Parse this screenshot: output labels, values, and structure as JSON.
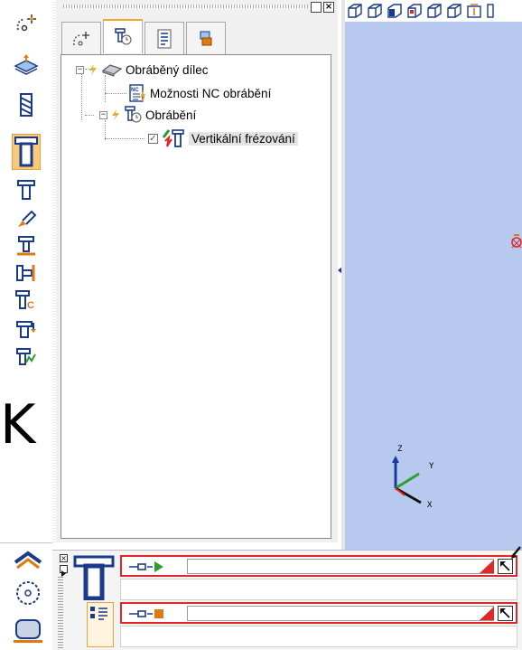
{
  "window": {
    "minimize_label": "",
    "close_label": "×"
  },
  "left_toolbar": {
    "active_index": 3,
    "icons": [
      "point-cursor-icon",
      "stock-layer-icon",
      "drill-icon",
      "vertical-mill-icon",
      "vertical-mill-small-icon",
      "pencil-mill-icon",
      "contour-mill-icon",
      "side-mill-icon",
      "nc-mill-icon",
      "mill-arrow-icon",
      "mill-chart-icon"
    ],
    "overlay_glyph": "K"
  },
  "left_bottom": {
    "icons": [
      "roof-icon",
      "saw-blade-icon",
      "rounded-rect-icon"
    ]
  },
  "panel_tabs": [
    {
      "icon": "point-tab-icon",
      "selected": false
    },
    {
      "icon": "operations-tab-icon",
      "selected": true
    },
    {
      "icon": "document-tab-icon",
      "selected": false
    },
    {
      "icon": "stack-tab-icon",
      "selected": false
    }
  ],
  "tree": {
    "nodes": [
      {
        "label": "Obráběný dílec",
        "icon": "workpiece-icon",
        "expanded": true
      },
      {
        "label": "Možnosti NC obrábění",
        "icon": "nc-options-icon"
      },
      {
        "label": "Obrábění",
        "icon": "machining-icon",
        "expanded": true
      },
      {
        "label": "Vertikální frézování",
        "icon": "vertical-milling-icon",
        "checked": true,
        "selected": true
      }
    ]
  },
  "viewport": {
    "background": "#b8c9f0",
    "view_icons": [
      "iso-view-icon",
      "front-view-icon",
      "top-view-icon",
      "back-view-icon",
      "left-view-icon",
      "right-view-icon",
      "fit-view-icon"
    ],
    "axes": {
      "z": "Z",
      "y": "Y",
      "x": "X"
    }
  },
  "bottom_panel": {
    "rows": [
      {
        "kind": "curve",
        "active": true,
        "accent": "#e02828"
      },
      {
        "kind": "blank"
      },
      {
        "kind": "stock",
        "active": true,
        "accent": "#e02828"
      },
      {
        "kind": "blank"
      }
    ]
  }
}
